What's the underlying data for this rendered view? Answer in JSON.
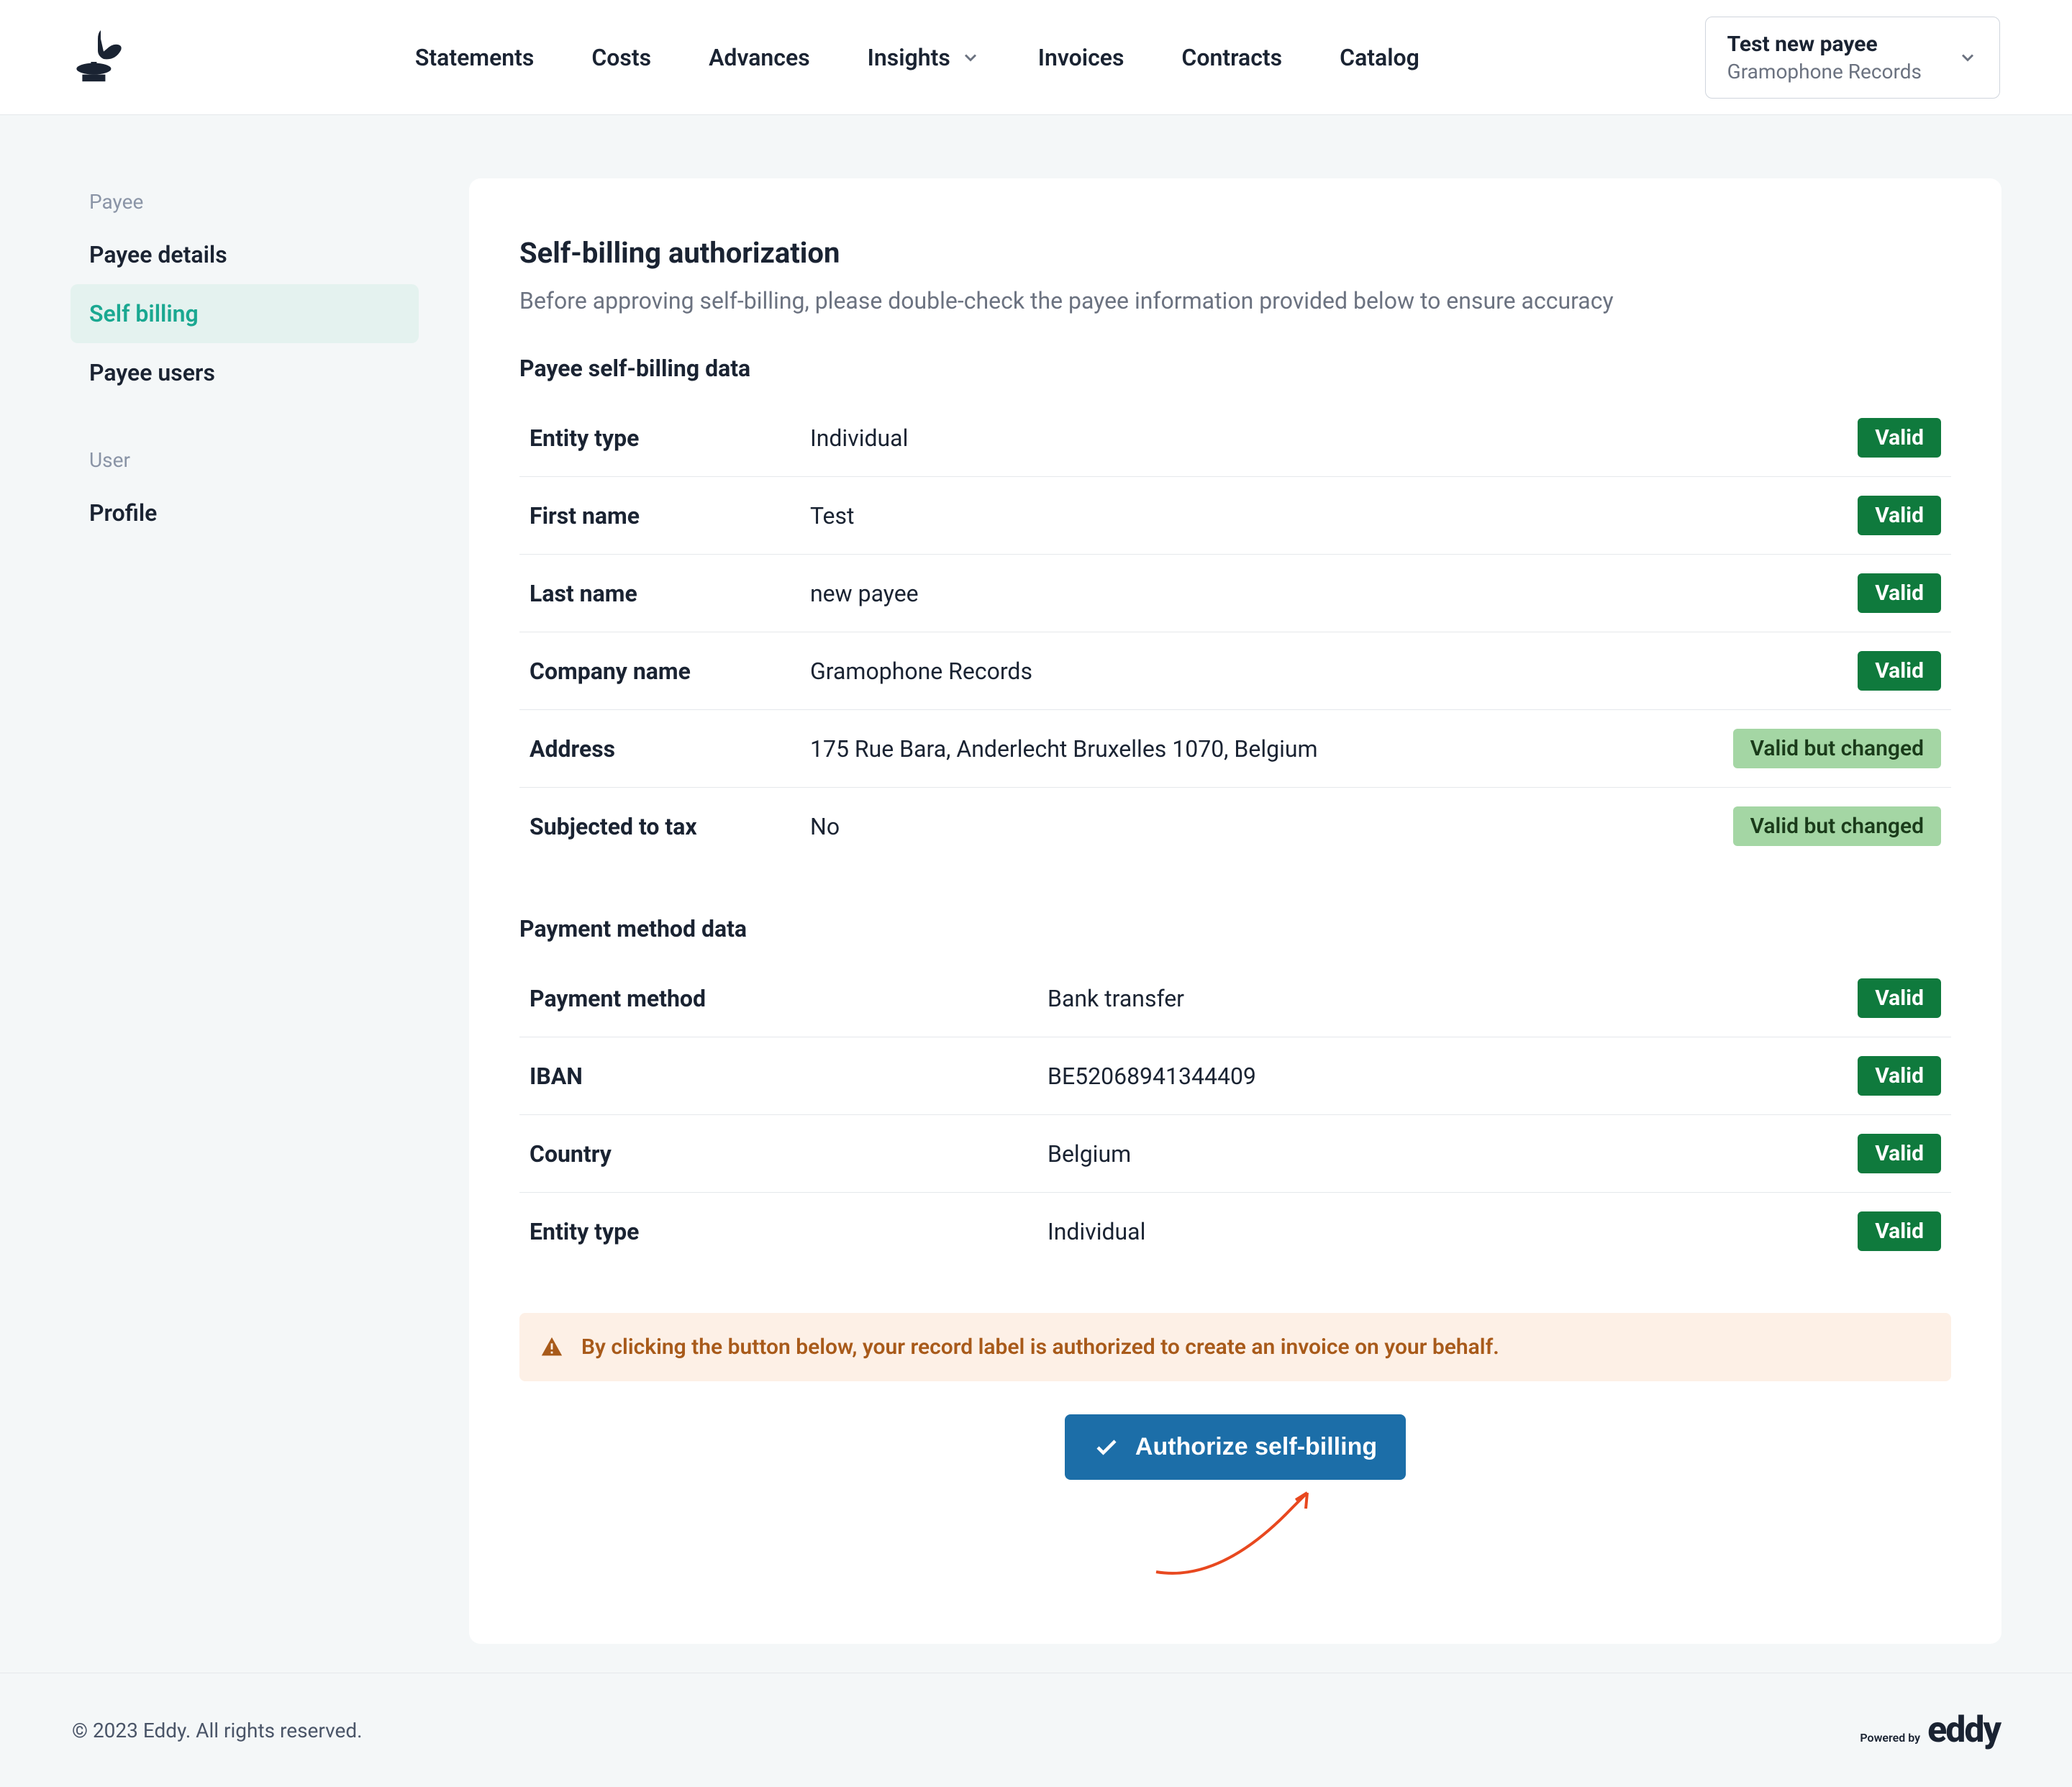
{
  "header": {
    "nav": {
      "statements": "Statements",
      "costs": "Costs",
      "advances": "Advances",
      "insights": "Insights",
      "invoices": "Invoices",
      "contracts": "Contracts",
      "catalog": "Catalog"
    },
    "account": {
      "name": "Test new payee",
      "sub": "Gramophone Records"
    }
  },
  "sidebar": {
    "sections": {
      "payee": {
        "label": "Payee",
        "items": {
          "details": "Payee details",
          "self_billing": "Self billing",
          "users": "Payee users"
        }
      },
      "user": {
        "label": "User",
        "items": {
          "profile": "Profile"
        }
      }
    }
  },
  "main": {
    "title": "Self-billing authorization",
    "description": "Before approving self-billing, please double-check the payee information provided below to ensure accuracy",
    "payee_heading": "Payee self-billing data",
    "payment_heading": "Payment method data",
    "payee_rows": [
      {
        "label": "Entity type",
        "value": "Individual",
        "status": "Valid",
        "status_type": "valid"
      },
      {
        "label": "First name",
        "value": "Test",
        "status": "Valid",
        "status_type": "valid"
      },
      {
        "label": "Last name",
        "value": "new payee",
        "status": "Valid",
        "status_type": "valid"
      },
      {
        "label": "Company name",
        "value": "Gramophone Records",
        "status": "Valid",
        "status_type": "valid"
      },
      {
        "label": "Address",
        "value": "175 Rue Bara, Anderlecht Bruxelles 1070, Belgium",
        "status": "Valid but changed",
        "status_type": "changed"
      },
      {
        "label": "Subjected to tax",
        "value": "No",
        "status": "Valid but changed",
        "status_type": "changed"
      }
    ],
    "payment_rows": [
      {
        "label": "Payment method",
        "value": "Bank transfer",
        "status": "Valid",
        "status_type": "valid"
      },
      {
        "label": "IBAN",
        "value": "BE52068941344409",
        "status": "Valid",
        "status_type": "valid"
      },
      {
        "label": "Country",
        "value": "Belgium",
        "status": "Valid",
        "status_type": "valid"
      },
      {
        "label": "Entity type",
        "value": "Individual",
        "status": "Valid",
        "status_type": "valid"
      }
    ],
    "alert": "By clicking the button below, your record label is authorized to create an invoice on your behalf.",
    "authorize_button": "Authorize self-billing"
  },
  "footer": {
    "copyright": "© 2023 Eddy. All rights reserved.",
    "powered_label": "Powered by",
    "powered_name": "eddy"
  }
}
